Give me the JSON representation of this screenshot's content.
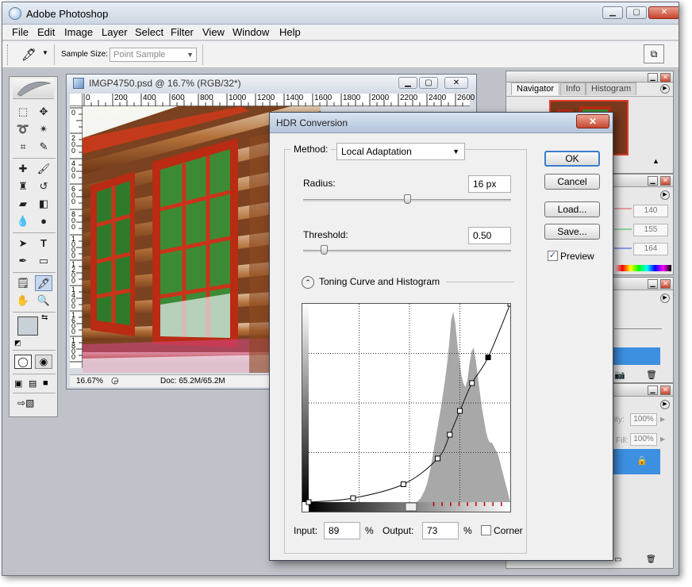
{
  "app": {
    "title": "Adobe Photoshop",
    "menu": [
      "File",
      "Edit",
      "Image",
      "Layer",
      "Select",
      "Filter",
      "View",
      "Window",
      "Help"
    ]
  },
  "options_bar": {
    "sample_size_label": "Sample Size:",
    "sample_size_value": "Point Sample"
  },
  "document": {
    "title": "IMGP4750.psd @ 16.7% (RGB/32*)",
    "ruler_h": [
      "0",
      "200",
      "400",
      "600",
      "800",
      "1000",
      "1200",
      "1400",
      "1600",
      "1800",
      "2000",
      "2200",
      "2400",
      "2600",
      "2"
    ],
    "ruler_v": [
      "0",
      "2\n0\n0",
      "4\n0\n0",
      "6\n0\n0",
      "8\n0\n0",
      "1\n0\n0\n0",
      "1\n2\n0\n0",
      "1\n4\n0\n0",
      "1\n6\n0\n0",
      "1\n8\n0\n0",
      "2\n0\n0\n0"
    ],
    "zoom": "16.67%",
    "doc_info": "Doc: 65.2M/65.2M"
  },
  "panels": {
    "navigator_tabs": [
      "Navigator",
      "Info",
      "Histogram"
    ],
    "color_values": [
      "140",
      "155",
      "164"
    ],
    "opacity_label": "ity:",
    "opacity": "100%",
    "fill_label": "Fill:",
    "fill": "100%"
  },
  "hdr": {
    "title": "HDR Conversion",
    "method_label": "Method:",
    "method_value": "Local Adaptation",
    "radius_label": "Radius:",
    "radius_value": "16 px",
    "radius_fraction": 0.5,
    "threshold_label": "Threshold:",
    "threshold_value": "0.50",
    "threshold_fraction": 0.1,
    "toning_label": "Toning Curve and Histogram",
    "input_label": "Input:",
    "input_value": "89",
    "output_label": "Output:",
    "output_value": "73",
    "percent": "%",
    "corner_label": "Corner",
    "buttons": {
      "ok": "OK",
      "cancel": "Cancel",
      "load": "Load...",
      "save": "Save..."
    },
    "preview_label": "Preview",
    "preview_checked": true,
    "curve_points": [
      [
        0,
        0
      ],
      [
        22,
        2
      ],
      [
        47,
        9
      ],
      [
        64,
        22
      ],
      [
        70,
        34
      ],
      [
        75,
        46
      ],
      [
        81,
        60
      ],
      [
        89,
        73
      ],
      [
        100,
        100
      ]
    ],
    "histogram": [
      0,
      0,
      0,
      0,
      0,
      0,
      0,
      0,
      0,
      0,
      0,
      0,
      0,
      0,
      0,
      0,
      0,
      0,
      0,
      0,
      0,
      0,
      0,
      0,
      0,
      0,
      0,
      0,
      0,
      0,
      0,
      0,
      0,
      0,
      0,
      0,
      0,
      0,
      0,
      0,
      0,
      0,
      0,
      0,
      0,
      0,
      0,
      0,
      0,
      0,
      0,
      0,
      0,
      0,
      1,
      2,
      4,
      6,
      9,
      13,
      18,
      24,
      30,
      36,
      42,
      48,
      55,
      62,
      70,
      80,
      92,
      96,
      90,
      80,
      72,
      64,
      60,
      58,
      62,
      70,
      76,
      78,
      72,
      64,
      56,
      48,
      42,
      36,
      32,
      30,
      30,
      28,
      26,
      24,
      20,
      16,
      12,
      8,
      4,
      0
    ]
  },
  "colors": {
    "accent": "#3b7cc8",
    "panel_highlight": "#3d8fe0"
  }
}
